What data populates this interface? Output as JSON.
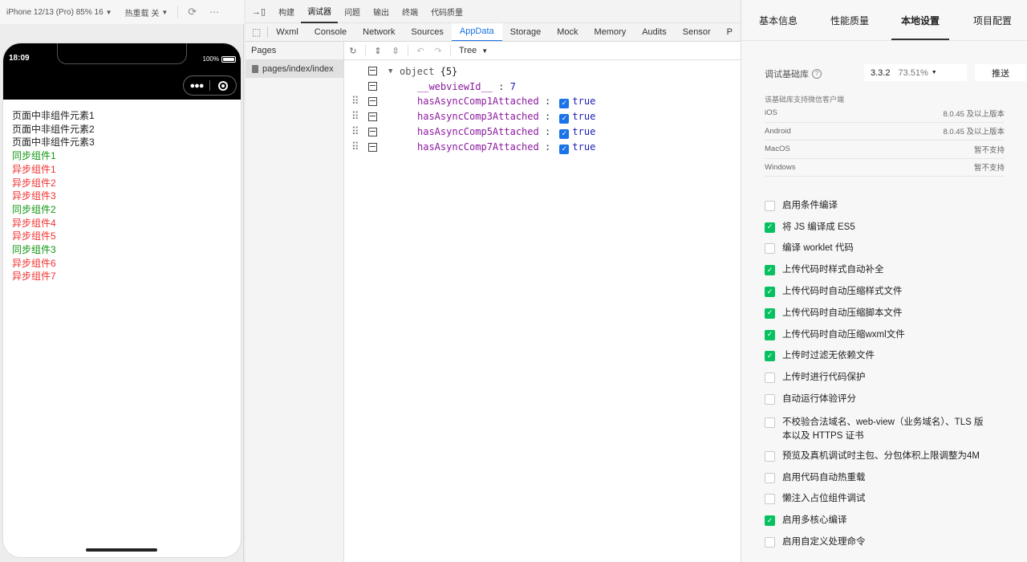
{
  "simulator": {
    "device": "iPhone 12/13 (Pro) 85% 16",
    "hot_reload": "热重载 关",
    "status_time": "18:09",
    "battery": "100%",
    "page_lines": [
      {
        "text": "页面中非组件元素1",
        "kind": "black"
      },
      {
        "text": "页面中非组件元素2",
        "kind": "black"
      },
      {
        "text": "页面中非组件元素3",
        "kind": "black"
      },
      {
        "text": "同步组件1",
        "kind": "green"
      },
      {
        "text": "异步组件1",
        "kind": "red"
      },
      {
        "text": "异步组件2",
        "kind": "red"
      },
      {
        "text": "异步组件3",
        "kind": "red"
      },
      {
        "text": "同步组件2",
        "kind": "green"
      },
      {
        "text": "异步组件4",
        "kind": "red"
      },
      {
        "text": "异步组件5",
        "kind": "red"
      },
      {
        "text": "同步组件3",
        "kind": "green"
      },
      {
        "text": "异步组件6",
        "kind": "red"
      },
      {
        "text": "异步组件7",
        "kind": "red"
      }
    ],
    "colors": {
      "green": "#119611",
      "red": "#f23030"
    }
  },
  "devtools": {
    "top_items": [
      "构建",
      "调试器",
      "问题",
      "输出",
      "终端",
      "代码质量"
    ],
    "top_active": "调试器",
    "tabs": [
      "Wxml",
      "Console",
      "Network",
      "Sources",
      "AppData",
      "Storage",
      "Mock",
      "Memory",
      "Audits",
      "Sensor",
      "P"
    ],
    "active_tab": "AppData",
    "pages_header": "Pages",
    "page_path": "pages/index/index",
    "tree_mode": "Tree",
    "tree": {
      "root_label": "object",
      "root_count": "{5}",
      "rows": [
        {
          "key": "__webviewId__",
          "type": "number",
          "value": "7"
        },
        {
          "key": "hasAsyncComp1Attached",
          "type": "bool",
          "value": "true"
        },
        {
          "key": "hasAsyncComp3Attached",
          "type": "bool",
          "value": "true"
        },
        {
          "key": "hasAsyncComp5Attached",
          "type": "bool",
          "value": "true"
        },
        {
          "key": "hasAsyncComp7Attached",
          "type": "bool",
          "value": "true"
        }
      ]
    }
  },
  "settings": {
    "tabs": [
      "基本信息",
      "性能质量",
      "本地设置",
      "项目配置"
    ],
    "active_tab": "本地设置",
    "lib_label": "调试基础库",
    "lib_version": "3.3.2",
    "lib_percent": "73.51%",
    "push_label": "推送",
    "support_note": "该基础库支持微信客户端",
    "platforms": [
      {
        "name": "iOS",
        "value": "8.0.45 及以上版本"
      },
      {
        "name": "Android",
        "value": "8.0.45 及以上版本"
      },
      {
        "name": "MacOS",
        "value": "暂不支持"
      },
      {
        "name": "Windows",
        "value": "暂不支持"
      }
    ],
    "options": [
      {
        "label": "启用条件编译",
        "checked": false
      },
      {
        "label": "将 JS 编译成 ES5",
        "checked": true
      },
      {
        "label": "编译 worklet 代码",
        "checked": false
      },
      {
        "label": "上传代码时样式自动补全",
        "checked": true
      },
      {
        "label": "上传代码时自动压缩样式文件",
        "checked": true
      },
      {
        "label": "上传代码时自动压缩脚本文件",
        "checked": true
      },
      {
        "label": "上传代码时自动压缩wxml文件",
        "checked": true
      },
      {
        "label": "上传时过滤无依赖文件",
        "checked": true
      },
      {
        "label": "上传时进行代码保护",
        "checked": false
      },
      {
        "label": "自动运行体验评分",
        "checked": false
      },
      {
        "label": "不校验合法域名、web-view（业务域名）、TLS 版本以及 HTTPS 证书",
        "checked": false
      },
      {
        "label": "预览及真机调试时主包、分包体积上限调整为4M",
        "checked": false
      },
      {
        "label": "启用代码自动热重载",
        "checked": false
      },
      {
        "label": "懒注入占位组件调试",
        "checked": false
      },
      {
        "label": "启用多核心编译",
        "checked": true
      },
      {
        "label": "启用自定义处理命令",
        "checked": false
      }
    ],
    "accent": "#07c160"
  }
}
